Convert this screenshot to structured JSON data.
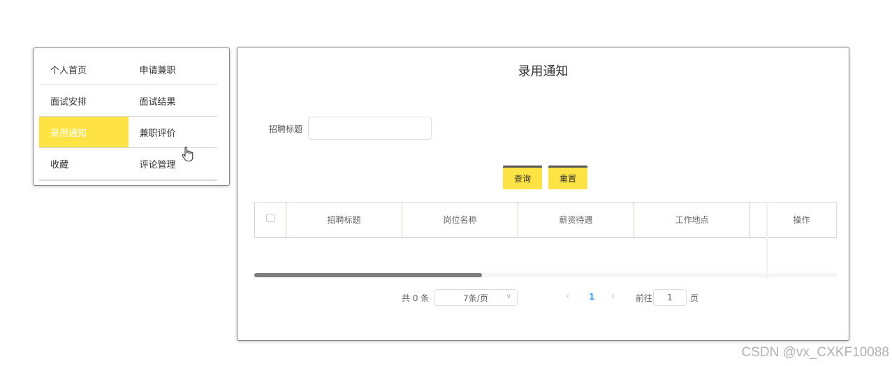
{
  "menu": {
    "rows": [
      [
        {
          "label": "个人首页"
        },
        {
          "label": "申请兼职"
        }
      ],
      [
        {
          "label": "面试安排"
        },
        {
          "label": "面试结果"
        }
      ],
      [
        {
          "label": "录用通知"
        },
        {
          "label": "兼职评价"
        }
      ],
      [
        {
          "label": "收藏"
        },
        {
          "label": "评论管理"
        }
      ]
    ],
    "active": "录用通知"
  },
  "main": {
    "title": "录用通知",
    "search": {
      "label": "招聘标题",
      "value": "",
      "placeholder": ""
    },
    "buttons": {
      "query_label": "查询",
      "reset_label": "重置"
    },
    "table": {
      "columns": [
        "招聘标题",
        "岗位名称",
        "薪资待遇",
        "工作地点",
        "操作"
      ],
      "rows": []
    },
    "pagination": {
      "total_text": "共 0 条",
      "page_size_text": "7条/页",
      "current_page": "1",
      "goto_label": "前往",
      "goto_value": "1",
      "page_suffix": "页"
    }
  },
  "watermark": "CSDN @vx_CXKF10088",
  "colors": {
    "accent": "#ffe243",
    "link": "#409eff"
  }
}
